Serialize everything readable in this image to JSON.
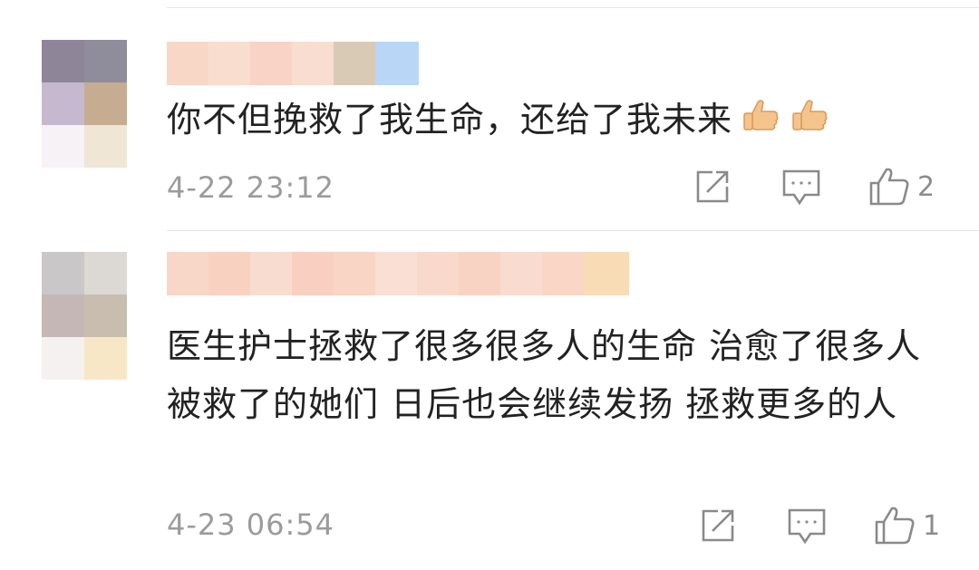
{
  "comments": [
    {
      "text": "你不但挽救了我生命，还给了我未来",
      "emoji": [
        "thumbs-up-emoji",
        "thumbs-up-emoji"
      ],
      "time": "4-22 23:12",
      "likes": "2"
    },
    {
      "text": "医生护士拯救了很多很多人的生命 治愈了很多人 被救了的她们 日后也会继续发扬 拯救更多的人",
      "time": "4-23 06:54",
      "likes": "1"
    }
  ],
  "icons": {
    "share": "share-icon",
    "reply": "reply-icon",
    "like": "thumbs-up-icon"
  },
  "colors": {
    "text": "#222222",
    "meta": "#9b9b9b",
    "separator": "#e6e6e6"
  }
}
